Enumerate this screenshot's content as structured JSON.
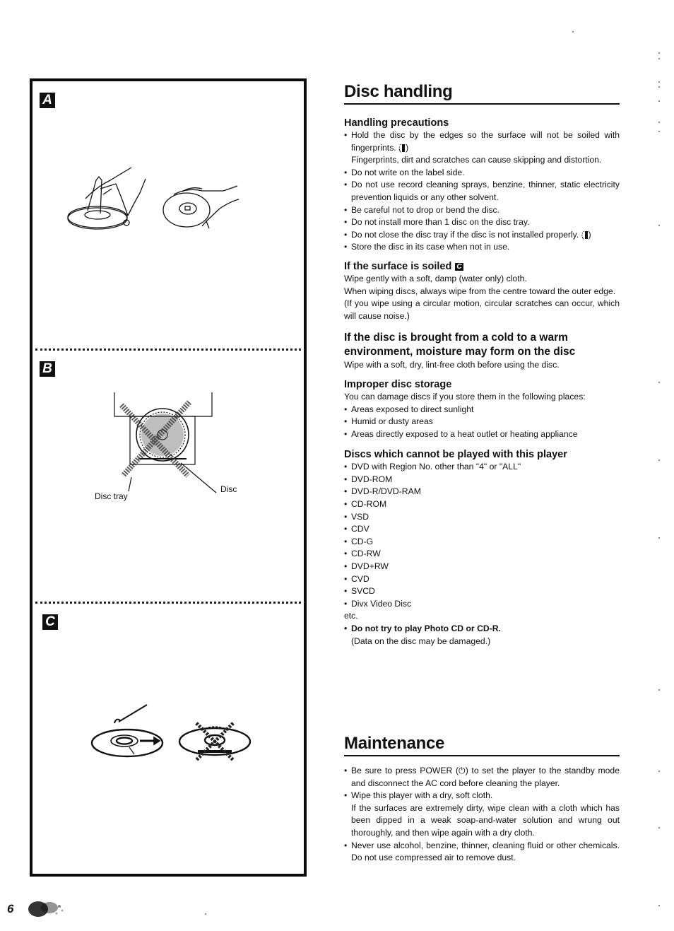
{
  "page_number": "6",
  "figures": {
    "A": {
      "badge": "A"
    },
    "B": {
      "badge": "B",
      "labels": {
        "disc_tray": "Disc tray",
        "disc": "Disc"
      }
    },
    "C": {
      "badge": "C"
    }
  },
  "disc_handling": {
    "title": "Disc handling",
    "handling_precautions": {
      "heading": "Handling precautions",
      "items": [
        {
          "text": "Hold the disc by the edges so the surface will not be soiled with fingerprints. (",
          "ref": "A",
          "after": ")",
          "note": "Fingerprints, dirt and scratches can cause skipping and distortion."
        },
        {
          "text": "Do not write on the label side."
        },
        {
          "text": "Do not use record cleaning sprays, benzine, thinner, static electricity prevention liquids or any other solvent."
        },
        {
          "text": "Be careful not to drop or bend the disc."
        },
        {
          "text": "Do not install more than 1 disc on the disc tray."
        },
        {
          "text": "Do not close the disc tray if the disc is not installed properly. (",
          "ref": "B",
          "after": ")"
        },
        {
          "text": "Store the disc in its case when not in use."
        }
      ]
    },
    "soiled": {
      "heading": "If the surface is soiled",
      "ref": "C",
      "lines": [
        "Wipe gently with a soft, damp (water only) cloth.",
        "When wiping discs, always wipe from the centre toward the outer edge.",
        "(If you wipe using a circular motion, circular scratches can occur, which will cause noise.)"
      ]
    },
    "moisture": {
      "heading": "If the disc is brought from a cold to a warm environment, moisture may form on the disc",
      "text": "Wipe with a soft, dry, lint-free cloth before using the disc."
    },
    "storage": {
      "heading": "Improper disc storage",
      "intro": "You can damage discs if you store them in the following places:",
      "items": [
        "Areas exposed to direct sunlight",
        "Humid or dusty areas",
        "Areas directly exposed to a heat outlet or heating appliance"
      ]
    },
    "cannot_play": {
      "heading": "Discs which cannot be played with this player",
      "items": [
        "DVD with Region No. other than \"4\" or \"ALL\"",
        "DVD-ROM",
        "DVD-R/DVD-RAM",
        "CD-ROM",
        "VSD",
        "CDV",
        "CD-G",
        "CD-RW",
        "DVD+RW",
        "CVD",
        "SVCD",
        "Divx Video Disc"
      ],
      "etc": "etc.",
      "warning": "Do not try to play Photo CD or CD-R.",
      "warning_note": "(Data on the disc may be damaged.)"
    }
  },
  "maintenance": {
    "title": "Maintenance",
    "items": [
      {
        "text": "Be sure to press POWER (⏻) to set the player to the standby mode and disconnect the AC cord before cleaning the player."
      },
      {
        "text": "Wipe this player with a dry, soft cloth.",
        "note": "If the surfaces are extremely dirty, wipe clean with a cloth which has been dipped in a weak soap-and-water solution and wrung out thoroughly, and then wipe again with a dry cloth."
      },
      {
        "text": "Never use alcohol, benzine, thinner, cleaning fluid or other chemicals. Do not use compressed air to remove dust."
      }
    ]
  }
}
